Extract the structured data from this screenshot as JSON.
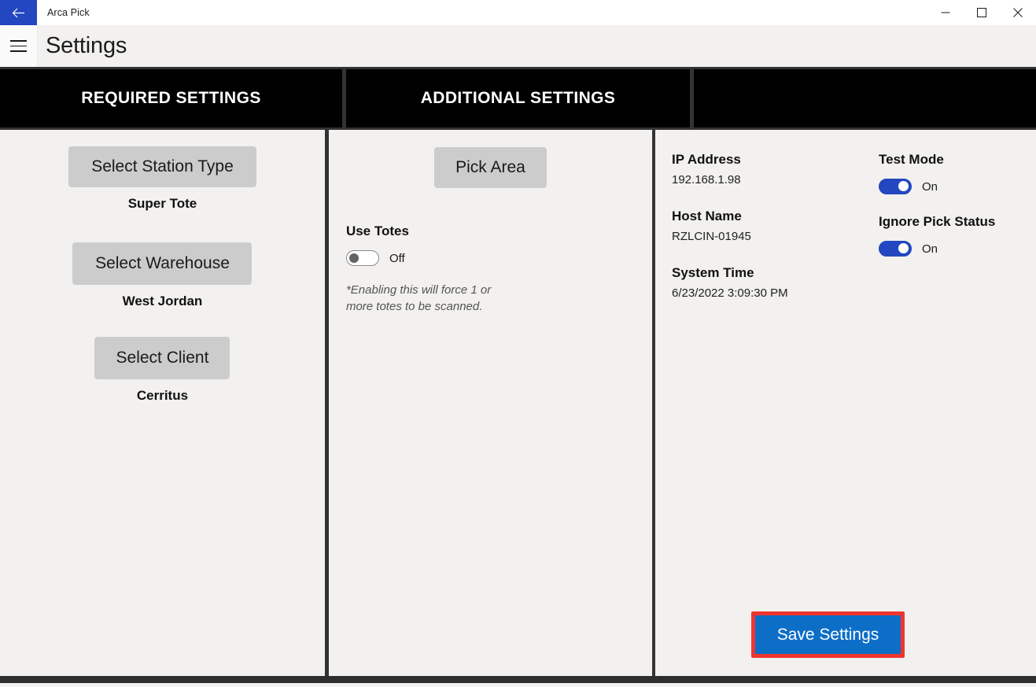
{
  "window": {
    "app_title": "Arca Pick",
    "back_icon": "back-arrow-icon",
    "minimize_label": "—",
    "maximize_label": "□",
    "close_label": "✕"
  },
  "commandbar": {
    "menu_icon": "hamburger-menu-icon",
    "page_title": "Settings"
  },
  "headers": {
    "required": "REQUIRED SETTINGS",
    "additional": "ADDITIONAL SETTINGS",
    "info": ""
  },
  "required_settings": {
    "station": {
      "button": "Select Station Type",
      "value": "Super Tote"
    },
    "warehouse": {
      "button": "Select Warehouse",
      "value": "West Jordan"
    },
    "client": {
      "button": "Select Client",
      "value": "Cerritus"
    }
  },
  "additional_settings": {
    "pick_area_button": "Pick Area",
    "use_totes": {
      "label": "Use Totes",
      "state": "Off",
      "note": "*Enabling this will force 1 or more totes to be scanned."
    }
  },
  "system_info": [
    {
      "label": "IP Address",
      "value": "192.168.1.98"
    },
    {
      "label": "Host Name",
      "value": "RZLCIN-01945"
    },
    {
      "label": "System Time",
      "value": "6/23/2022 3:09:30 PM"
    }
  ],
  "switches": [
    {
      "label": "Test Mode",
      "state": "On"
    },
    {
      "label": "Ignore Pick Status",
      "state": "On"
    }
  ],
  "actions": {
    "save_label": "Save Settings"
  },
  "colors": {
    "accent_blue": "#2347c0",
    "save_blue": "#0d6ec8",
    "highlight_red": "#f0352f",
    "header_black": "#000000",
    "divider_gray": "#333333",
    "page_bg": "#f2f1ef",
    "button_gray": "#cccccc"
  }
}
